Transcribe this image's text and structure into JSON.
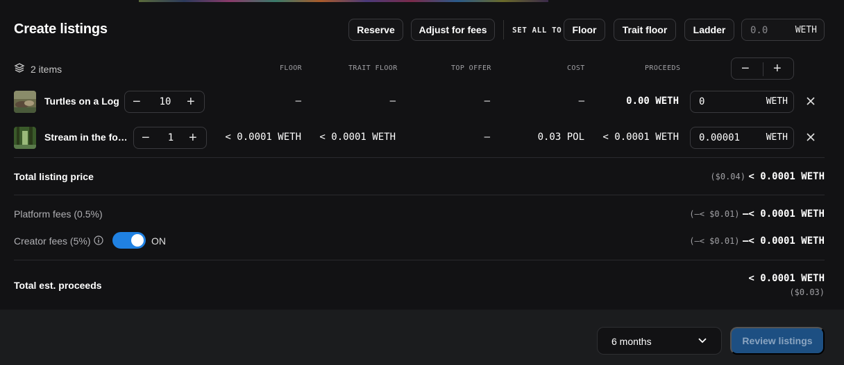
{
  "title": "Create listings",
  "toolbar": {
    "reserve_label": "Reserve",
    "adjust_label": "Adjust for fees",
    "set_all_label": "SET ALL TO",
    "floor_label": "Floor",
    "trait_floor_label": "Trait floor",
    "ladder_label": "Ladder",
    "price_placeholder": "0.0",
    "price_currency": "WETH"
  },
  "summary": {
    "items_count": "2 items"
  },
  "columns": [
    "FLOOR",
    "TRAIT FLOOR",
    "TOP OFFER",
    "COST",
    "PROCEEDS"
  ],
  "rows": [
    {
      "name": "Turtles on a Log",
      "quantity": "10",
      "floor": "–",
      "trait_floor": "–",
      "top_offer": "–",
      "cost": "–",
      "proceeds": "0.00 WETH",
      "price": "0",
      "currency": "WETH"
    },
    {
      "name": "Stream in the fo…",
      "quantity": "1",
      "floor": "< 0.0001 WETH",
      "trait_floor": "< 0.0001 WETH",
      "top_offer": "–",
      "cost": "0.03 POL",
      "proceeds": "< 0.0001 WETH",
      "price": "0.00001",
      "currency": "WETH"
    }
  ],
  "totals": {
    "listing_price_label": "Total listing price",
    "listing_price_usd": "($0.04)",
    "listing_price_amount": "< 0.0001 WETH",
    "platform_fees_label": "Platform fees (0.5%)",
    "platform_fees_usd": "(–< $0.01)",
    "platform_fees_amount": "–< 0.0001 WETH",
    "creator_fees_label": "Creator fees (5%)",
    "creator_fees_toggle": "ON",
    "creator_fees_usd": "(–< $0.01)",
    "creator_fees_amount": "–< 0.0001 WETH",
    "proceeds_label": "Total est. proceeds",
    "proceeds_amount": "< 0.0001 WETH",
    "proceeds_usd": "($0.03)"
  },
  "footer": {
    "duration": "6 months",
    "review_label": "Review listings"
  },
  "colors": {
    "accent": "#2081e2",
    "review_button": "#1d4f82",
    "background": "#121214"
  },
  "icons": [
    "layers-icon",
    "minus-icon",
    "plus-icon",
    "close-icon",
    "info-icon",
    "chevron-down-icon"
  ]
}
